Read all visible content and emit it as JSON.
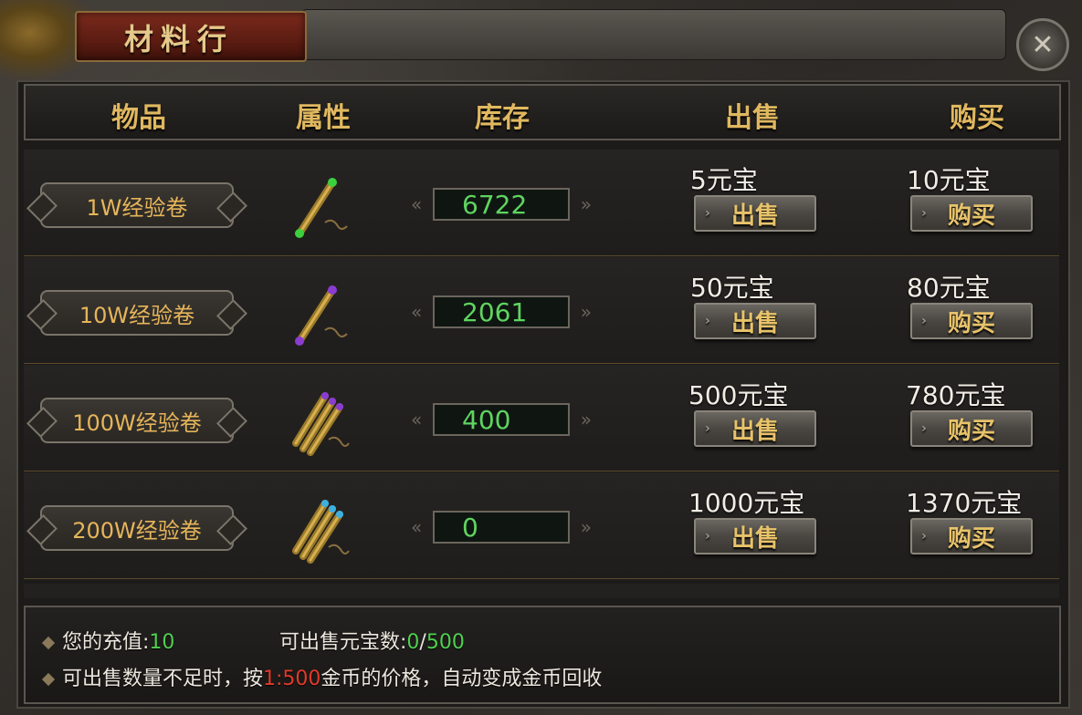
{
  "window": {
    "title": "材料行",
    "close_icon": "close-x-icon"
  },
  "headers": {
    "item": "物品",
    "attribute": "属性",
    "stock": "库存",
    "sell": "出售",
    "buy": "购买"
  },
  "rows": [
    {
      "name": "1W经验卷",
      "icon": "scroll-green-icon",
      "stock": "6722",
      "sell_price": "5元宝",
      "sell_label": "出售",
      "buy_price": "10元宝",
      "buy_label": "购买"
    },
    {
      "name": "10W经验卷",
      "icon": "scroll-purple-icon",
      "stock": "2061",
      "sell_price": "50元宝",
      "sell_label": "出售",
      "buy_price": "80元宝",
      "buy_label": "购买"
    },
    {
      "name": "100W经验卷",
      "icon": "scroll-bundle-purple-icon",
      "stock": "400",
      "sell_price": "500元宝",
      "sell_label": "出售",
      "buy_price": "780元宝",
      "buy_label": "购买"
    },
    {
      "name": "200W经验卷",
      "icon": "scroll-bundle-blue-icon",
      "stock": "0",
      "sell_price": "1000元宝",
      "sell_label": "出售",
      "buy_price": "1370元宝",
      "buy_label": "购买"
    }
  ],
  "footer": {
    "recharge_label": "您的充值:",
    "recharge_value": "10",
    "sellable_label": "可出售元宝数:",
    "sellable_current": "0",
    "sellable_sep": "/",
    "sellable_max": "500",
    "notice_prefix": "可出售数量不足时，按",
    "notice_ratio": "1:500",
    "notice_suffix": "金币的价格，自动变成金币回收"
  },
  "colors": {
    "gold_text": "#e0b860",
    "stock_green": "#5fd45f",
    "ratio_red": "#e23a2a"
  }
}
